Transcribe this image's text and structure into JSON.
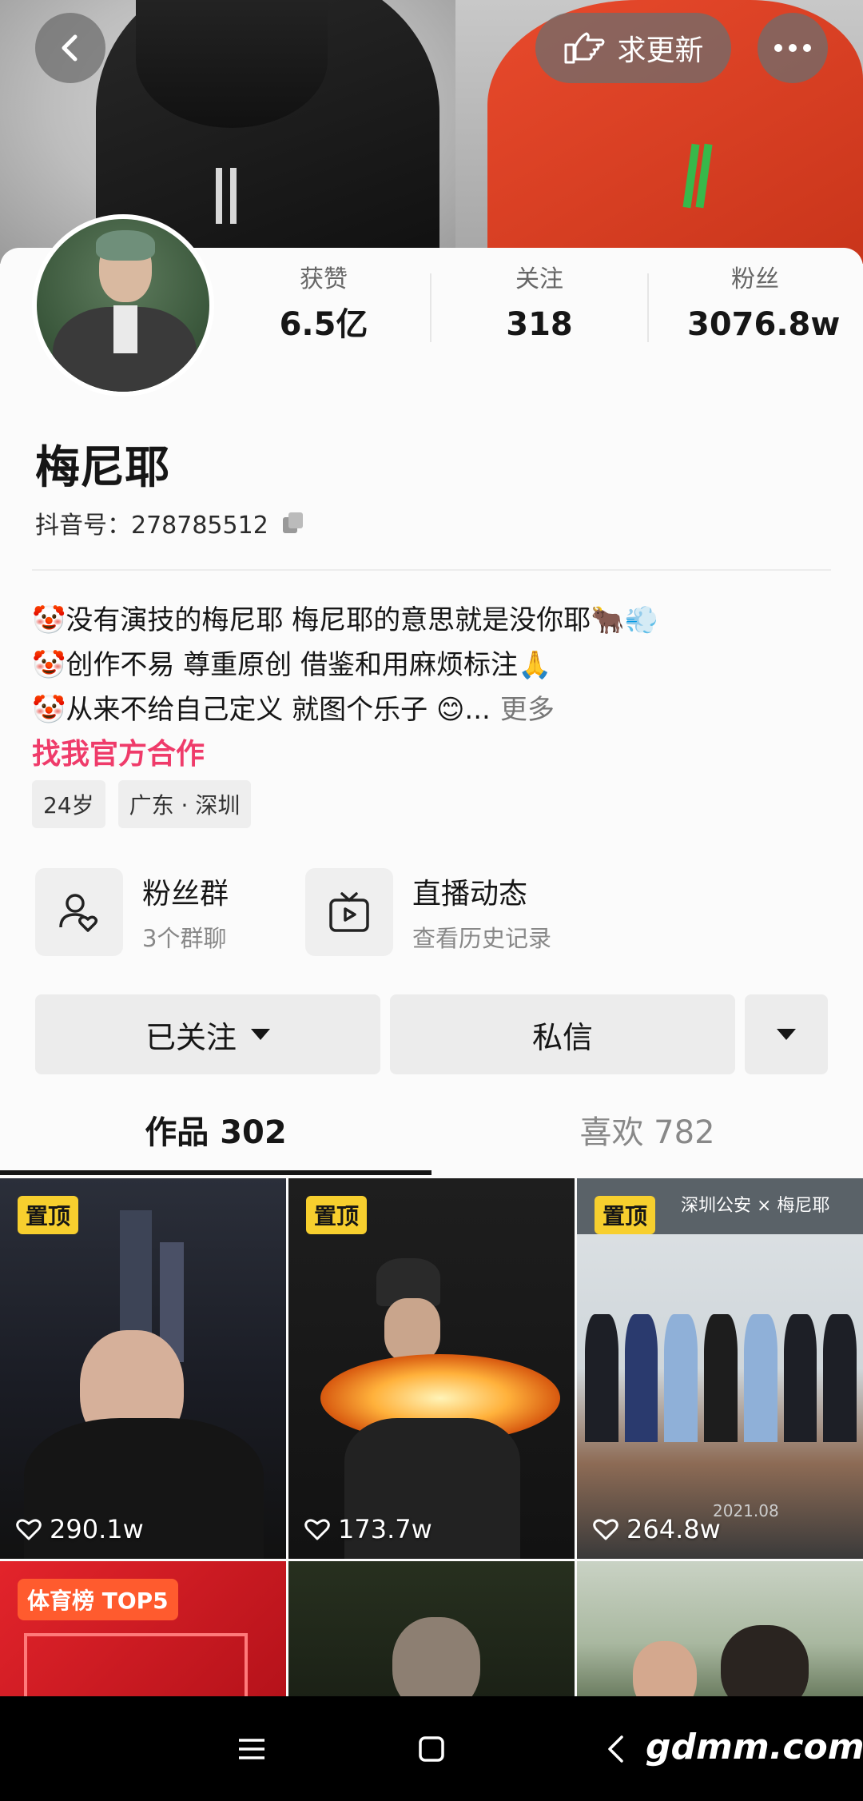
{
  "header": {
    "request_update_label": "求更新"
  },
  "profile": {
    "name": "梅尼耶",
    "douyin_id": "抖音号：278785512",
    "stats": [
      {
        "label": "获赞",
        "value": "6.5亿"
      },
      {
        "label": "关注",
        "value": "318"
      },
      {
        "label": "粉丝",
        "value": "3076.8w"
      }
    ],
    "bio_lines": [
      "🤡没有演技的梅尼耶 梅尼耶的意思就是没你耶🐂💨",
      "🤡创作不易 尊重原创  借鉴和用麻烦标注🙏",
      "🤡从来不给自己定义 就图个乐子 😊..."
    ],
    "bio_more": "更多",
    "official_link": "找我官方合作",
    "tags": [
      "24岁",
      "广东 · 深圳"
    ]
  },
  "features": [
    {
      "title": "粉丝群",
      "subtitle": "3个群聊",
      "icon": "fan-group-icon"
    },
    {
      "title": "直播动态",
      "subtitle": "查看历史记录",
      "icon": "tv-icon"
    }
  ],
  "actions": {
    "followed_label": "已关注",
    "message_label": "私信"
  },
  "tabs": [
    {
      "label": "作品 302",
      "active": true
    },
    {
      "label": "喜欢 782",
      "active": false
    }
  ],
  "videos": [
    {
      "badge": "置顶",
      "likes": "290.1w"
    },
    {
      "badge": "置顶",
      "likes": "173.7w"
    },
    {
      "badge": "置顶",
      "likes": "264.8w",
      "overlay_title": "深圳公安 × 梅尼耶",
      "date": "2021.08"
    },
    {
      "badge": "体育榜 TOP5"
    },
    {},
    {}
  ],
  "watermark": "gdmm.com",
  "colors": {
    "accent_pink": "#ef3b6a",
    "pin_yellow": "#f7cf2e",
    "rank_orange": "#ff5b2e"
  }
}
